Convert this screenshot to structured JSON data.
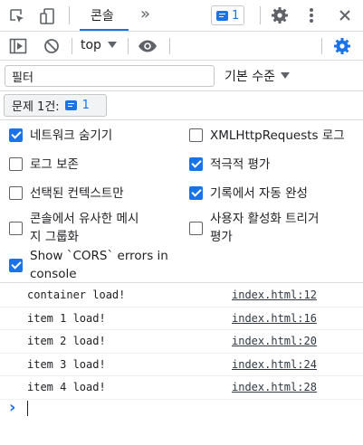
{
  "toolbar": {
    "tab_console": "콘솔",
    "more_tabs": "»",
    "message_count": "1"
  },
  "console_toolbar": {
    "context": "top"
  },
  "filter": {
    "placeholder": "필터",
    "level": "기본 수준"
  },
  "issues": {
    "label": "문제 1건:",
    "count": "1"
  },
  "settings": [
    {
      "label": "네트워크 숨기기",
      "checked": true
    },
    {
      "label": "XMLHttpRequests 로그",
      "checked": false
    },
    {
      "label": "로그 보존",
      "checked": false
    },
    {
      "label": "적극적 평가",
      "checked": true
    },
    {
      "label": "선택된 컨텍스트만",
      "checked": false
    },
    {
      "label": "기록에서 자동 완성",
      "checked": true
    },
    {
      "label": "콘솔에서 유사한 메시지 그룹화",
      "line1": "콘솔에서 유사한 메시",
      "line2": "지 그룹화",
      "checked": false
    },
    {
      "label": "사용자 활성화 트리거 평가",
      "line1": "사용자 활성화 트리거",
      "line2": "평가",
      "checked": false
    },
    {
      "label": "Show `CORS` errors in console",
      "line1": "Show `CORS` errors in",
      "line2": "console",
      "checked": true
    }
  ],
  "logs": [
    {
      "message": "container load!",
      "source": "index.html:12"
    },
    {
      "message": "item 1 load!",
      "source": "index.html:16"
    },
    {
      "message": "item 2 load!",
      "source": "index.html:20"
    },
    {
      "message": "item 3 load!",
      "source": "index.html:24"
    },
    {
      "message": "item 4 load!",
      "source": "index.html:28"
    }
  ],
  "prompt": {
    "symbol": "›"
  },
  "colors": {
    "accent": "#1a73e8",
    "icon": "#5f6368"
  }
}
